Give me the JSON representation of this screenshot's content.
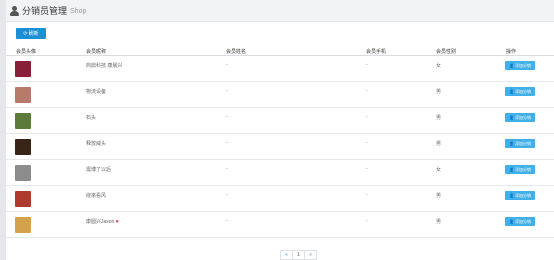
{
  "header": {
    "title": "分销员管理",
    "subtitle": "Shop"
  },
  "toolbar": {
    "refresh_label": "刷新"
  },
  "table": {
    "columns": [
      "会员头像",
      "会员昵称",
      "会员姓名",
      "会员手机",
      "会员性别",
      "操作"
    ],
    "rows": [
      {
        "nickname": "商鼎科技 康晨兴",
        "name": "-",
        "phone": "-",
        "gender": "女",
        "action": "添加分销",
        "avatar_color": "#8a1f3a"
      },
      {
        "nickname": "物流设备",
        "name": "-",
        "phone": "-",
        "gender": "男",
        "action": "添加分销",
        "avatar_color": "#b87a6a"
      },
      {
        "nickname": "石头",
        "name": "-",
        "phone": "-",
        "gender": "男",
        "action": "添加分销",
        "avatar_color": "#5c7a3a"
      },
      {
        "nickname": "释放威头",
        "name": "-",
        "phone": "-",
        "gender": "男",
        "action": "添加分销",
        "avatar_color": "#3a2418"
      },
      {
        "nickname": "需博了以后",
        "name": "-",
        "phone": "-",
        "gender": "女",
        "action": "添加分销",
        "avatar_color": "#8c8c8c"
      },
      {
        "nickname": "绕來看风",
        "name": "-",
        "phone": "-",
        "gender": "男",
        "action": "添加分销",
        "avatar_color": "#b03a2e"
      },
      {
        "nickname": "康圆兴Jason",
        "name": "-",
        "phone": "-",
        "gender": "男",
        "action": "添加分销",
        "avatar_color": "#d4a24a"
      }
    ]
  },
  "pager": {
    "prev": "«",
    "current": "1",
    "next": "»"
  }
}
